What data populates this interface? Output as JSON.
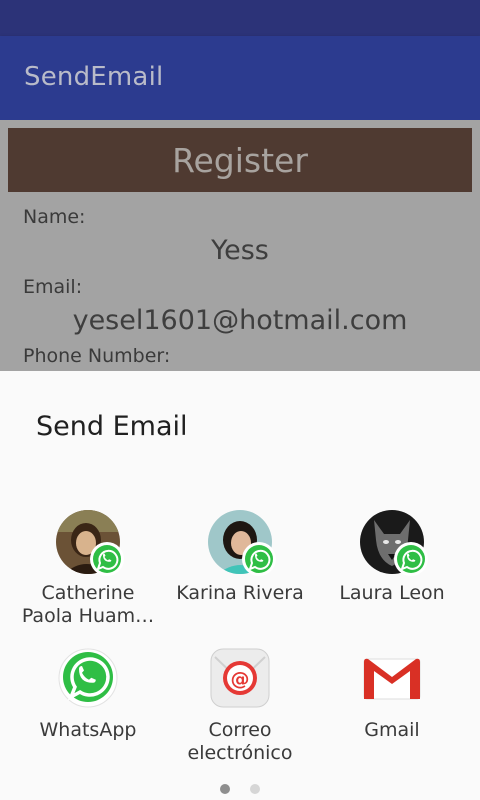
{
  "app_bar": {
    "title": "SendEmail"
  },
  "form": {
    "header": "Register",
    "name_label": "Name:",
    "name_value": "Yess",
    "email_label": "Email:",
    "email_value": "yesel1601@hotmail.com",
    "phone_label": "Phone Number:"
  },
  "share_sheet": {
    "title": "Send Email",
    "contacts": [
      {
        "name_line1": "Catherine",
        "name_line2": "Paola Huam…",
        "app": "whatsapp-icon"
      },
      {
        "name_line1": "Karina Rivera",
        "name_line2": "",
        "app": "whatsapp-icon"
      },
      {
        "name_line1": "Laura Leon",
        "name_line2": "",
        "app": "whatsapp-icon"
      }
    ],
    "apps": [
      {
        "label_line1": "WhatsApp",
        "label_line2": "",
        "icon": "whatsapp-icon"
      },
      {
        "label_line1": "Correo",
        "label_line2": "electrónico",
        "icon": "email-app-icon"
      },
      {
        "label_line1": "Gmail",
        "label_line2": "",
        "icon": "gmail-icon"
      }
    ],
    "pager": {
      "pages": 2,
      "current": 1
    }
  },
  "colors": {
    "status_bar": "#2c3378",
    "app_bar": "#2c3b8f",
    "register_bar": "#4f3a31",
    "whatsapp_green": "#2fbe45",
    "email_red": "#e53935",
    "gmail_red": "#d93025"
  }
}
